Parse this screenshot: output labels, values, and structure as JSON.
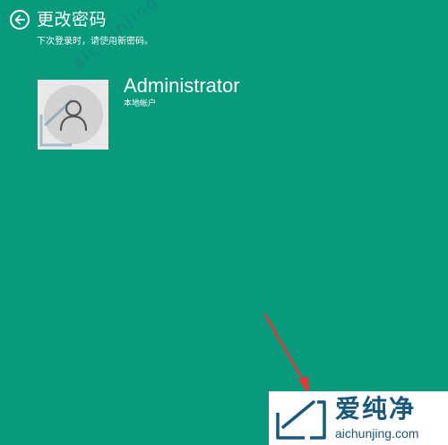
{
  "header": {
    "title": "更改密码",
    "back_icon": "back-arrow-circle-icon"
  },
  "subtitle": "下次登录时，请使用新密码。",
  "account": {
    "name": "Administrator",
    "type": "本地帐户",
    "avatar_icon": "user-avatar-icon"
  },
  "watermark": {
    "brand": "爱纯净",
    "url": "aichunjing.com",
    "logo_icon": "aichunjing-logo-icon"
  },
  "colors": {
    "background": "#079a7d",
    "text": "#ffffff",
    "annotation_arrow": "#e53935",
    "watermark_text": "#17577d"
  }
}
